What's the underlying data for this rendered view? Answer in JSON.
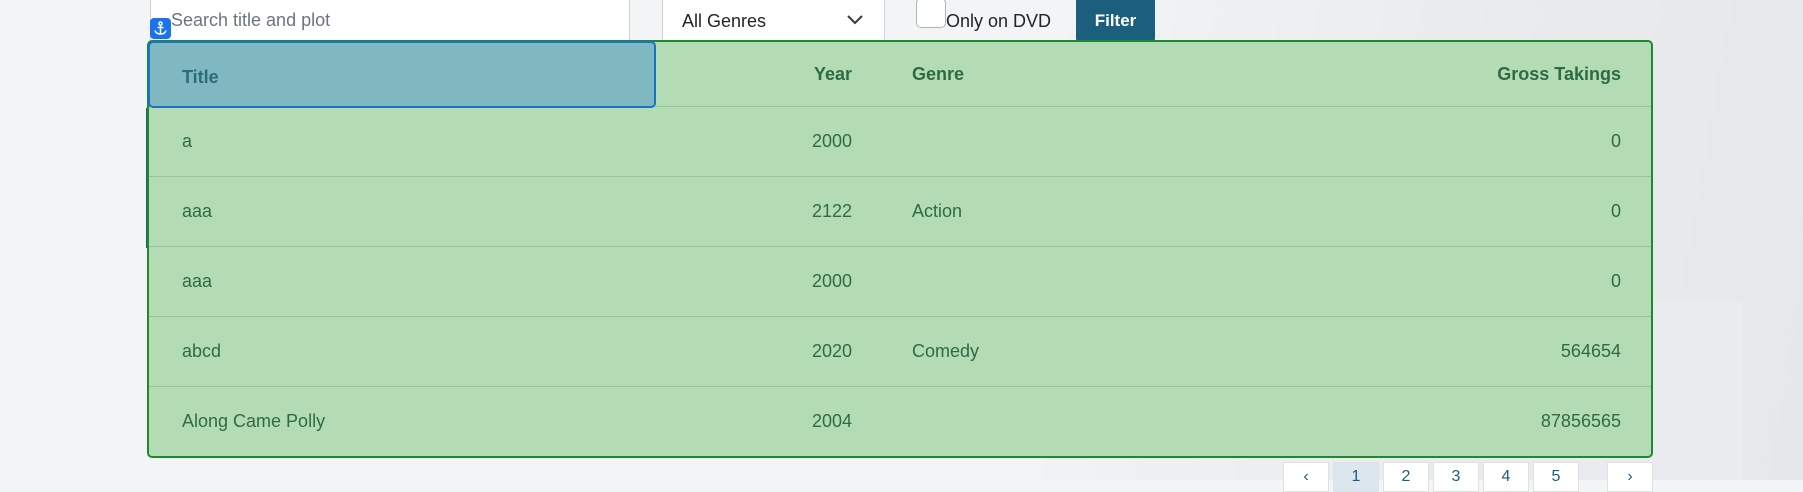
{
  "filters": {
    "search_placeholder": "Search title and plot",
    "genre_selected": "All Genres",
    "dvd_label": "Only on DVD",
    "filter_button": "Filter"
  },
  "table": {
    "headers": {
      "title": "Title",
      "year": "Year",
      "genre": "Genre",
      "gross": "Gross Takings"
    },
    "rows": [
      {
        "title": "a",
        "year": "2000",
        "genre": "",
        "gross": "0"
      },
      {
        "title": "aaa",
        "year": "2122",
        "genre": "Action",
        "gross": "0"
      },
      {
        "title": "aaa",
        "year": "2000",
        "genre": "",
        "gross": "0"
      },
      {
        "title": "abcd",
        "year": "2020",
        "genre": "Comedy",
        "gross": "564654"
      },
      {
        "title": "Along Came Polly",
        "year": "2004",
        "genre": "",
        "gross": "87856565"
      }
    ]
  },
  "pagination": {
    "prev": "‹",
    "pages": [
      "1",
      "2",
      "3",
      "4",
      "5"
    ],
    "next": "›",
    "current": "1"
  },
  "colors": {
    "highlight_green": "#b4dcb4",
    "highlight_blue": "#7fb8c0",
    "primary": "#1b5e7e"
  },
  "icons": {
    "anchor": "anchor-icon",
    "dropdown": "chevron-down-icon"
  }
}
